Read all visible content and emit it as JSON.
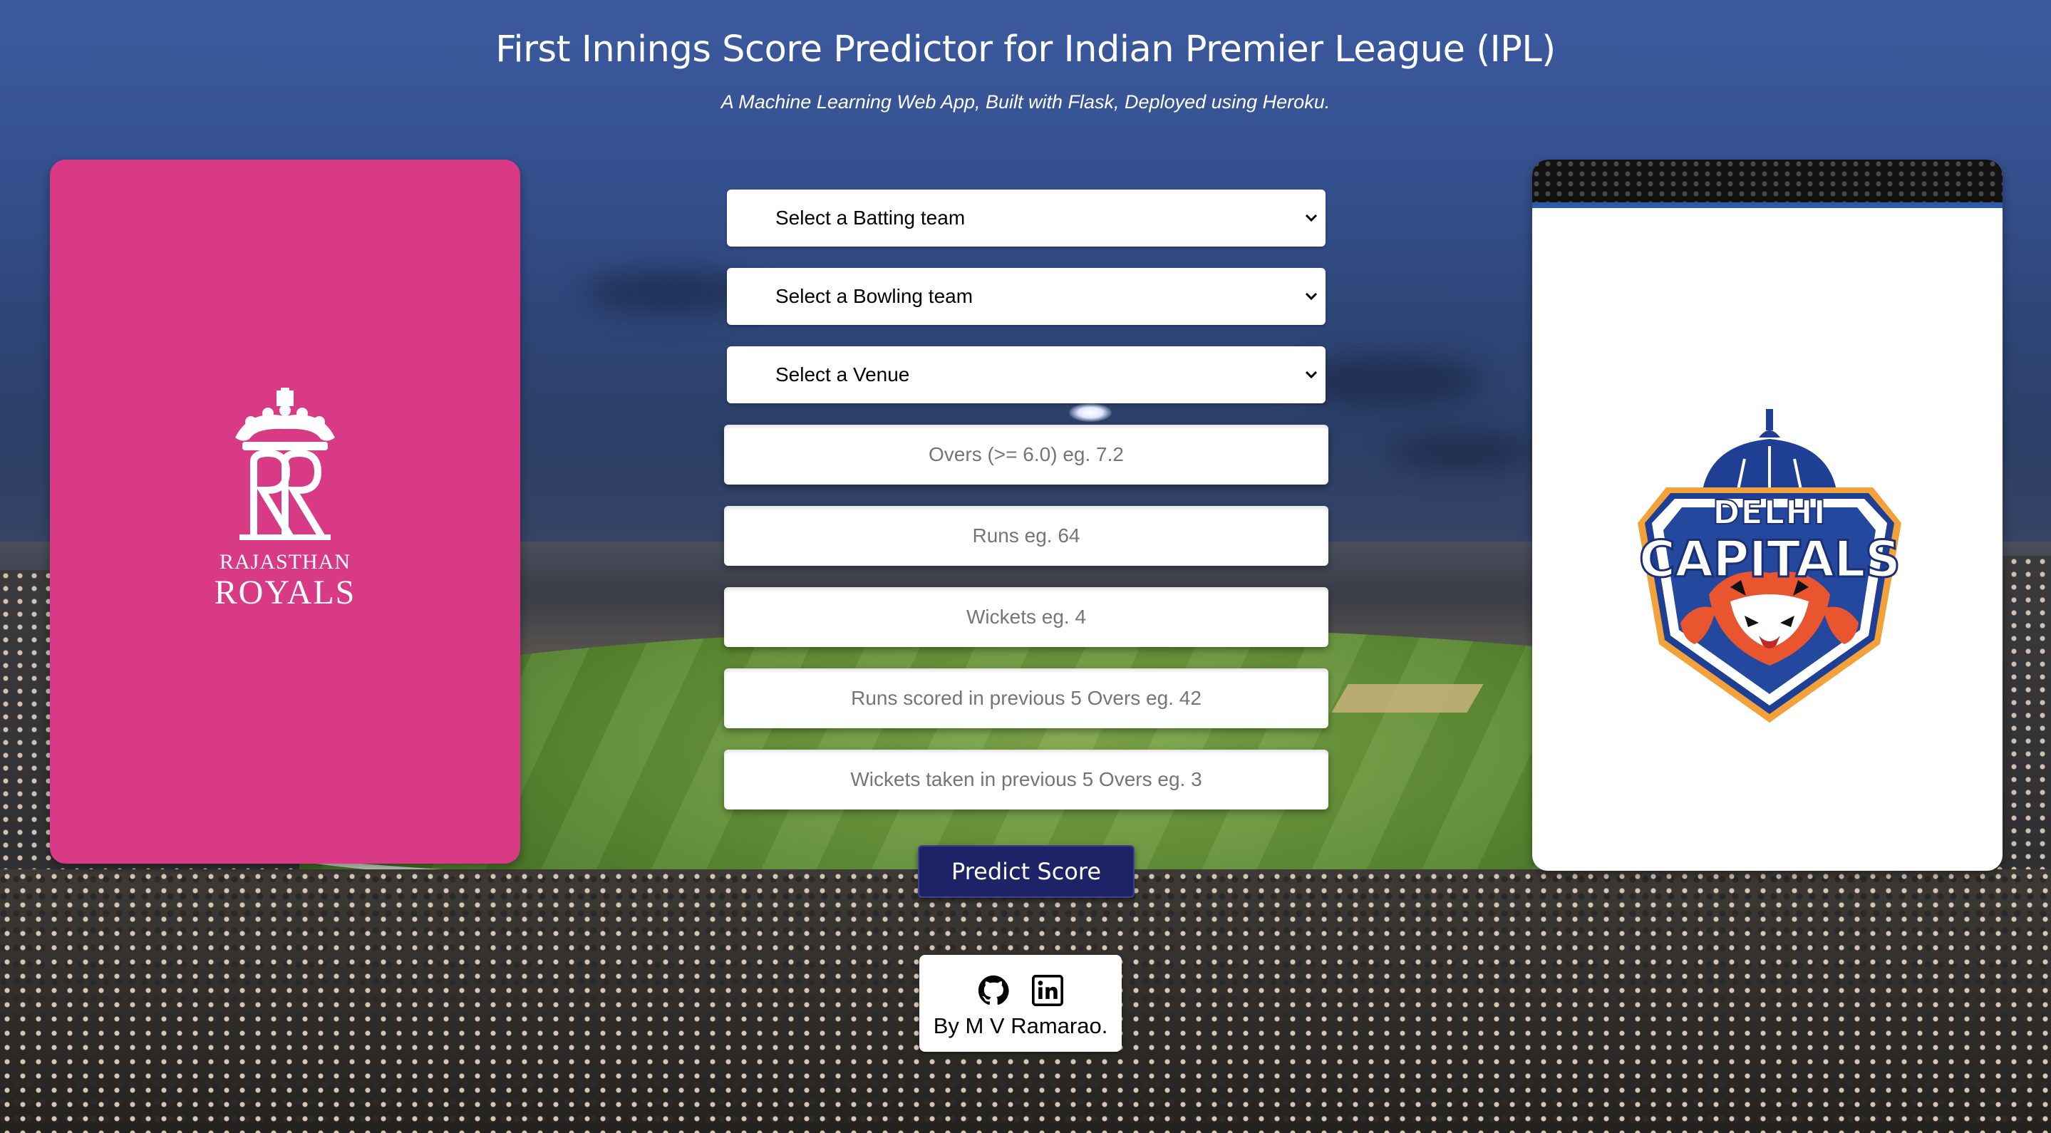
{
  "header": {
    "title": "First Innings Score Predictor for Indian Premier League (IPL)",
    "subtitle": "A Machine Learning Web App, Built with Flask, Deployed using Heroku."
  },
  "left_card": {
    "team_line1": "RAJASTHAN",
    "team_line2": "ROYALS",
    "background_color": "#d93a86",
    "logo_icon": "rajasthan-royals-crown-logo"
  },
  "right_card": {
    "team_line1": "DELHI",
    "team_line2": "CAPITALS",
    "logo_icon": "delhi-capitals-tiger-crest-logo",
    "primary_color": "#1f3f94",
    "accent_color": "#e03a2c"
  },
  "form": {
    "batting_team": {
      "selected": "Select a Batting team"
    },
    "bowling_team": {
      "selected": "Select a Bowling team"
    },
    "venue": {
      "selected": "Select a Venue"
    },
    "overs_placeholder": "Overs (>= 6.0) eg. 7.2",
    "runs_placeholder": "Runs eg. 64",
    "wickets_placeholder": "Wickets eg. 4",
    "runs_last5_placeholder": "Runs scored in previous 5 Overs eg. 42",
    "wickets_last5_placeholder": "Wickets taken in previous 5 Overs eg. 3",
    "submit_label": "Predict Score",
    "button_color": "#1e2367"
  },
  "footer": {
    "byline": "By M V Ramarao.",
    "icons": [
      "github-icon",
      "linkedin-icon"
    ]
  }
}
